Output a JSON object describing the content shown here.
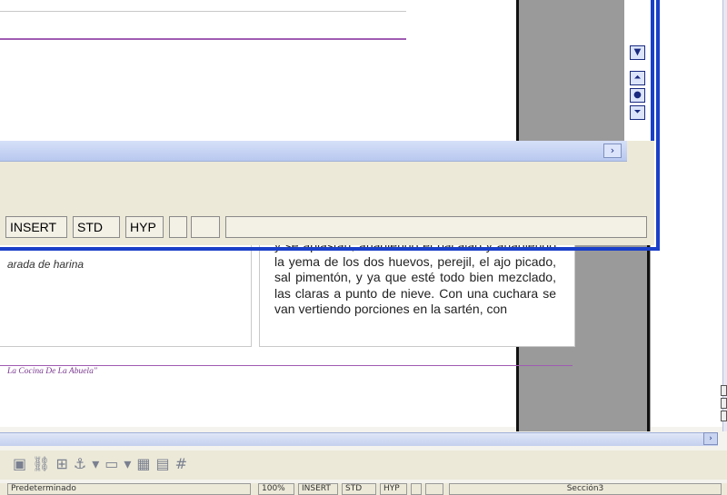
{
  "document": {
    "right_paragraph": "y se aplastan, añadiendo el bacalao y añadiendo la yema de los dos huevos, perejil, el ajo picado, sal pimentón, y ya que esté todo bien mezclado, las claras a punto de nieve. Con una cuchara se van vertiendo porciones en la sartén, con",
    "left_italic": "arada de harina",
    "footer": "La Cocina De La Abuela\""
  },
  "front_window": {
    "status": {
      "insert": "INSERT",
      "std": "STD",
      "hyp": "HYP"
    },
    "scroll_right_icon": "chevron-right-icon",
    "vscroll": {
      "down_icon": "chevron-down-icon",
      "prev_icon": "previous-page-icon",
      "nav_icon": "navigator-circle-icon",
      "next_icon": "next-page-icon"
    }
  },
  "main_window": {
    "status": {
      "page_style": "Predeterminado",
      "zoom": "100%",
      "insert": "INSERT",
      "std": "STD",
      "hyp": "HYP",
      "section": "Sección3"
    },
    "toolbar_icons": [
      "frame-icon",
      "link-icon",
      "wrap-icon",
      "anchor-icon",
      "chevron-down-icon",
      "border-icon",
      "chevron-down-icon",
      "table-icon",
      "chart-icon",
      "grid-icon"
    ]
  }
}
